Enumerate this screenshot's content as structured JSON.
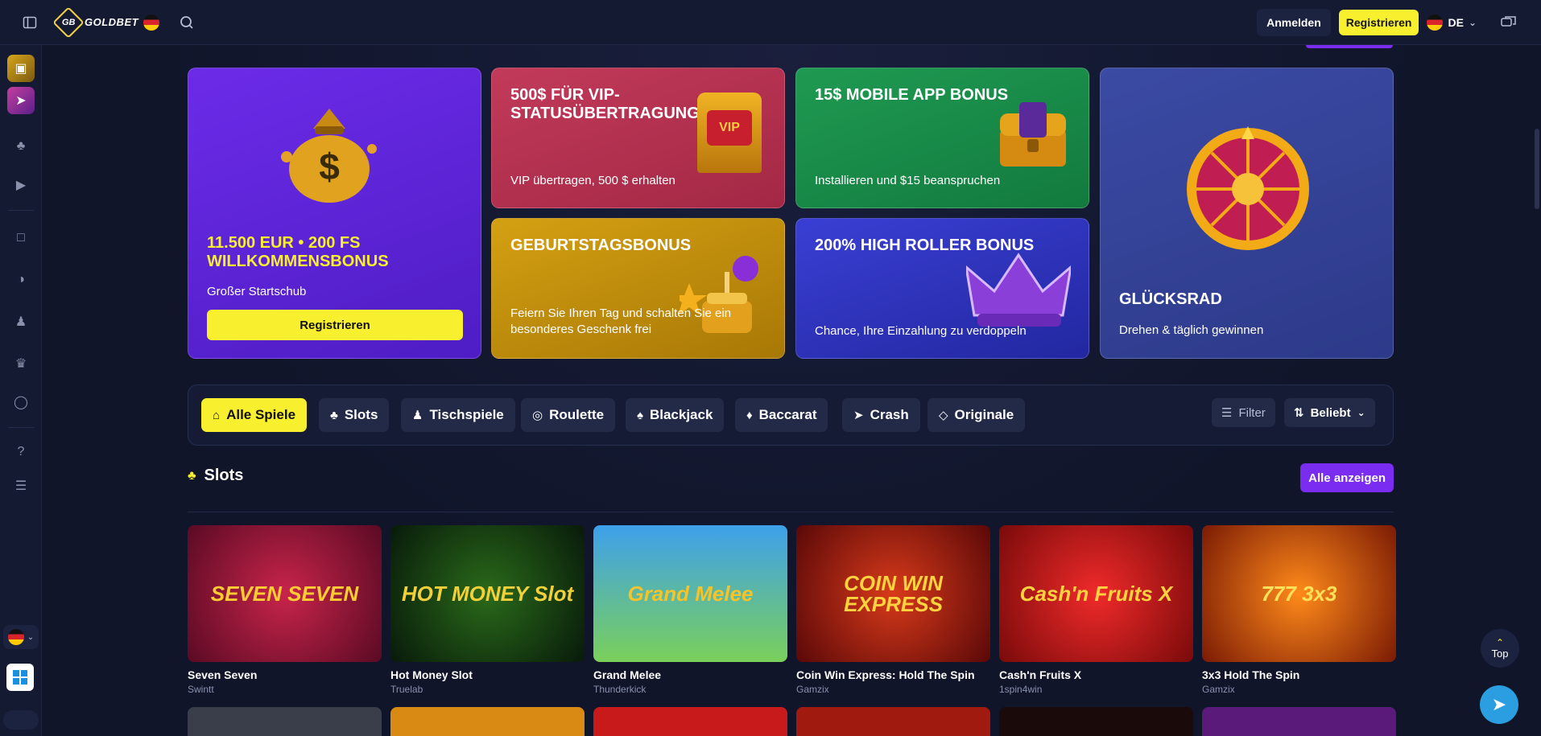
{
  "header": {
    "logo_text": "GOLDBET",
    "logo_mark": "GB",
    "login_label": "Anmelden",
    "register_label": "Registrieren",
    "language": "DE",
    "icons": {
      "sidebar_toggle": "sidebar-toggle-icon",
      "search": "search-icon",
      "chat": "chat-icon"
    }
  },
  "sidebar": {
    "items": [
      {
        "name": "slots",
        "icon": "cherry-icon"
      },
      {
        "name": "live",
        "icon": "video-camera-icon"
      },
      {
        "name": "promotions",
        "icon": "gift-icon"
      },
      {
        "name": "games",
        "icon": "gamepad-icon"
      },
      {
        "name": "tournaments",
        "icon": "trophy-icon"
      },
      {
        "name": "vip",
        "icon": "crown-icon"
      },
      {
        "name": "support",
        "icon": "headset-icon"
      },
      {
        "name": "help",
        "icon": "help-circle-icon"
      },
      {
        "name": "list",
        "icon": "list-icon"
      }
    ]
  },
  "promos": {
    "welcome": {
      "title": "11.500 EUR • 200 FS WILLKOMMENSBONUS",
      "subtitle": "Großer Startschub",
      "cta": "Registrieren"
    },
    "vip": {
      "title": "500$ FÜR VIP-STATUSÜBERTRAGUNG",
      "subtitle": "VIP übertragen, 500 $ erhalten",
      "badge": "VIP"
    },
    "app": {
      "title": "15$ MOBILE APP BONUS",
      "subtitle": "Installieren und $15 beanspruchen"
    },
    "birthday": {
      "title": "GEBURTSTAGSBONUS",
      "subtitle": "Feiern Sie Ihren Tag und schalten Sie ein besonderes Geschenk frei"
    },
    "highroller": {
      "title": "200% HIGH ROLLER BONUS",
      "subtitle": "Chance, Ihre Einzahlung zu verdoppeln"
    },
    "wheel": {
      "title": "GLÜCKSRAD",
      "subtitle": "Drehen & täglich gewinnen"
    }
  },
  "filters": {
    "tabs": [
      {
        "label": "Alle Spiele",
        "icon": "home-icon",
        "active": true
      },
      {
        "label": "Slots",
        "icon": "cherry-icon",
        "active": false
      },
      {
        "label": "Tischspiele",
        "icon": "chess-pawn-icon",
        "active": false
      },
      {
        "label": "Roulette",
        "icon": "roulette-icon",
        "active": false
      },
      {
        "label": "Blackjack",
        "icon": "cards-icon",
        "active": false
      },
      {
        "label": "Baccarat",
        "icon": "card-icon",
        "active": false
      },
      {
        "label": "Crash",
        "icon": "rocket-icon",
        "active": false
      },
      {
        "label": "Originale",
        "icon": "diamond-icon",
        "active": false
      }
    ],
    "filter_label": "Filter",
    "sort_label": "Beliebt"
  },
  "slots_section": {
    "title": "Slots",
    "show_all": "Alle anzeigen",
    "games": [
      {
        "name": "Seven Seven",
        "provider": "Swintt",
        "art": "SEVEN SEVEN",
        "color": "#8b1230"
      },
      {
        "name": "Hot Money Slot",
        "provider": "Truelab",
        "art": "HOT MONEY Slot",
        "color": "#0f3a18"
      },
      {
        "name": "Grand Melee",
        "provider": "Thunderkick",
        "art": "Grand Melee",
        "color": "#2f8fd8"
      },
      {
        "name": "Coin Win Express: Hold The Spin",
        "provider": "Gamzix",
        "art": "COIN WIN EXPRESS",
        "color": "#a01818"
      },
      {
        "name": "Cash'n Fruits X",
        "provider": "1spin4win",
        "art": "Cash'n Fruits X",
        "color": "#c81818"
      },
      {
        "name": "3x3 Hold The Spin",
        "provider": "Gamzix",
        "art": "777 3x3",
        "color": "#c83608"
      }
    ]
  },
  "floating": {
    "top_label": "Top"
  }
}
